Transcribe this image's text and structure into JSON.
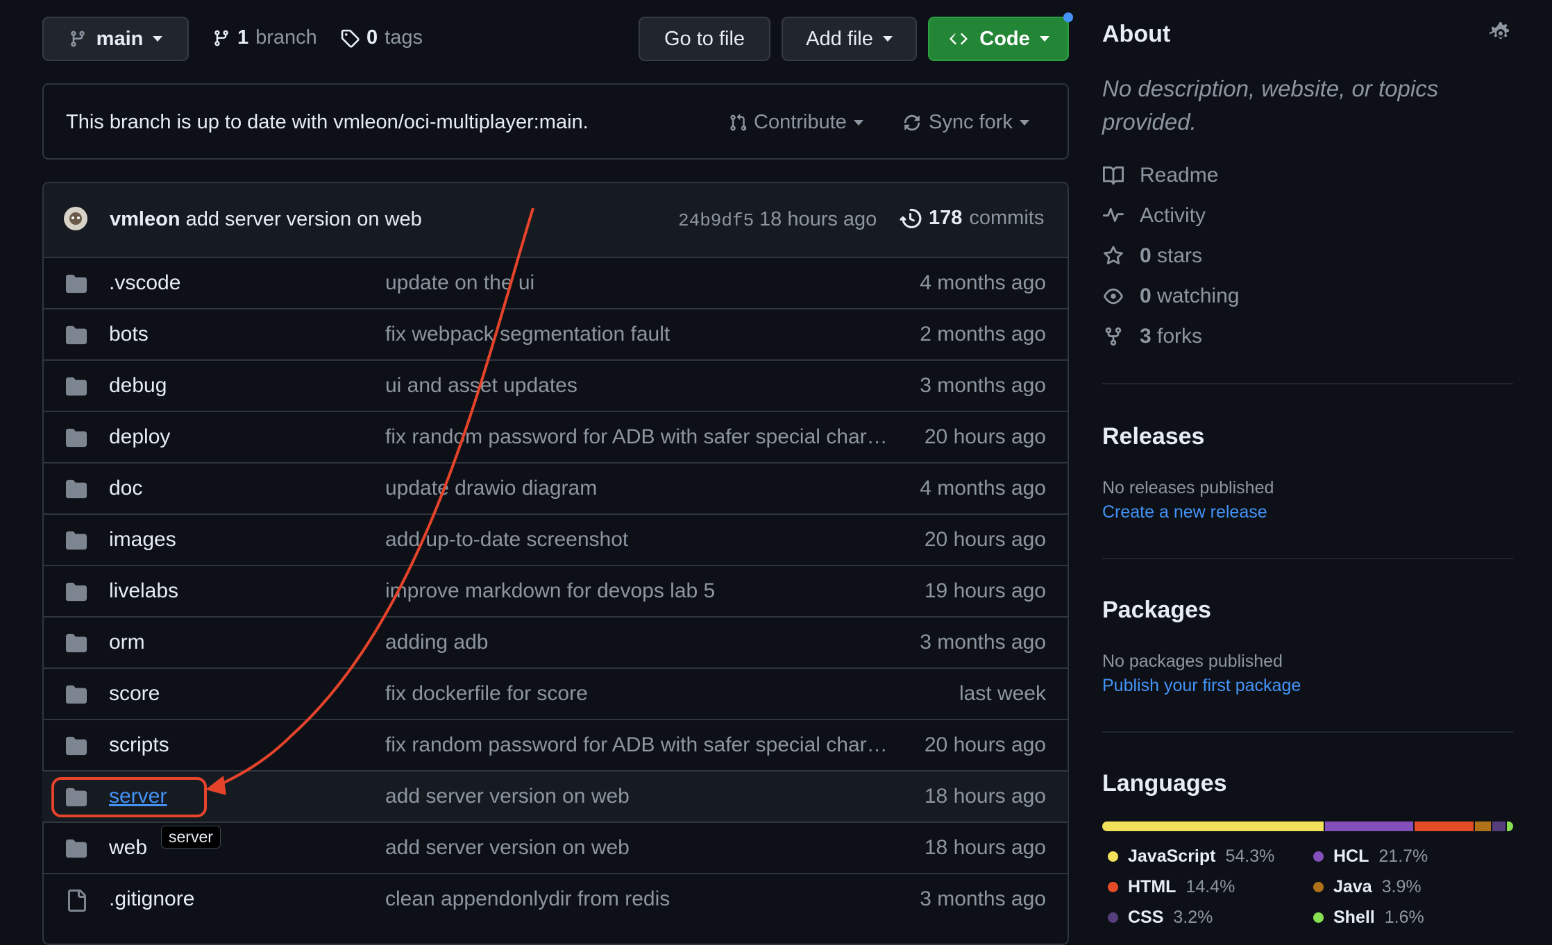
{
  "toolbar": {
    "branch_select": "main",
    "branches_count": "1",
    "branches_label": "branch",
    "tags_count": "0",
    "tags_label": "tags",
    "go_to_file": "Go to file",
    "add_file": "Add file",
    "code": "Code"
  },
  "branch_status": {
    "text": "This branch is up to date with vmleon/oci-multiplayer:main.",
    "contribute": "Contribute",
    "sync_fork": "Sync fork"
  },
  "latest_commit": {
    "author": "vmleon",
    "message": "add server version on web",
    "sha": "24b9df5",
    "time": "18 hours ago",
    "commits_count": "178",
    "commits_label": "commits"
  },
  "files": [
    {
      "type": "dir",
      "name": ".vscode",
      "message": "update on the ui",
      "time": "4 months ago"
    },
    {
      "type": "dir",
      "name": "bots",
      "message": "fix webpack segmentation fault",
      "time": "2 months ago"
    },
    {
      "type": "dir",
      "name": "debug",
      "message": "ui and asset updates",
      "time": "3 months ago"
    },
    {
      "type": "dir",
      "name": "deploy",
      "message": "fix random password for ADB with safer special char…",
      "time": "20 hours ago"
    },
    {
      "type": "dir",
      "name": "doc",
      "message": "update drawio diagram",
      "time": "4 months ago"
    },
    {
      "type": "dir",
      "name": "images",
      "message": "add up-to-date screenshot",
      "time": "20 hours ago"
    },
    {
      "type": "dir",
      "name": "livelabs",
      "message": "improve markdown for devops lab 5",
      "time": "19 hours ago"
    },
    {
      "type": "dir",
      "name": "orm",
      "message": "adding adb",
      "time": "3 months ago"
    },
    {
      "type": "dir",
      "name": "score",
      "message": "fix dockerfile for score",
      "time": "last week"
    },
    {
      "type": "dir",
      "name": "scripts",
      "message": "fix random password for ADB with safer special char…",
      "time": "20 hours ago"
    },
    {
      "type": "dir",
      "name": "server",
      "message": "add server version on web",
      "time": "18 hours ago"
    },
    {
      "type": "dir",
      "name": "web",
      "message": "add server version on web",
      "time": "18 hours ago"
    },
    {
      "type": "file",
      "name": ".gitignore",
      "message": "clean appendonlydir from redis",
      "time": "3 months ago"
    }
  ],
  "tooltip": "server",
  "about": {
    "title": "About",
    "description": "No description, website, or topics provided.",
    "readme": "Readme",
    "activity": "Activity",
    "stars_count": "0",
    "stars_label": "stars",
    "watching_count": "0",
    "watching_label": "watching",
    "forks_count": "3",
    "forks_label": "forks"
  },
  "releases": {
    "title": "Releases",
    "empty": "No releases published",
    "link": "Create a new release"
  },
  "packages": {
    "title": "Packages",
    "empty": "No packages published",
    "link": "Publish your first package"
  },
  "languages": {
    "title": "Languages",
    "items": [
      {
        "name": "JavaScript",
        "pct": "54.3%",
        "value": 54.3,
        "color": "#f1e05a"
      },
      {
        "name": "HCL",
        "pct": "21.7%",
        "value": 21.7,
        "color": "#844fba"
      },
      {
        "name": "HTML",
        "pct": "14.4%",
        "value": 14.4,
        "color": "#e34c26"
      },
      {
        "name": "Java",
        "pct": "3.9%",
        "value": 3.9,
        "color": "#b07219"
      },
      {
        "name": "CSS",
        "pct": "3.2%",
        "value": 3.2,
        "color": "#563d7c"
      },
      {
        "name": "Shell",
        "pct": "1.6%",
        "value": 1.6,
        "color": "#89e051"
      }
    ]
  },
  "colors": {
    "accent_link": "#4493f8",
    "code_button": "#238636",
    "annotation": "#e5432a"
  }
}
